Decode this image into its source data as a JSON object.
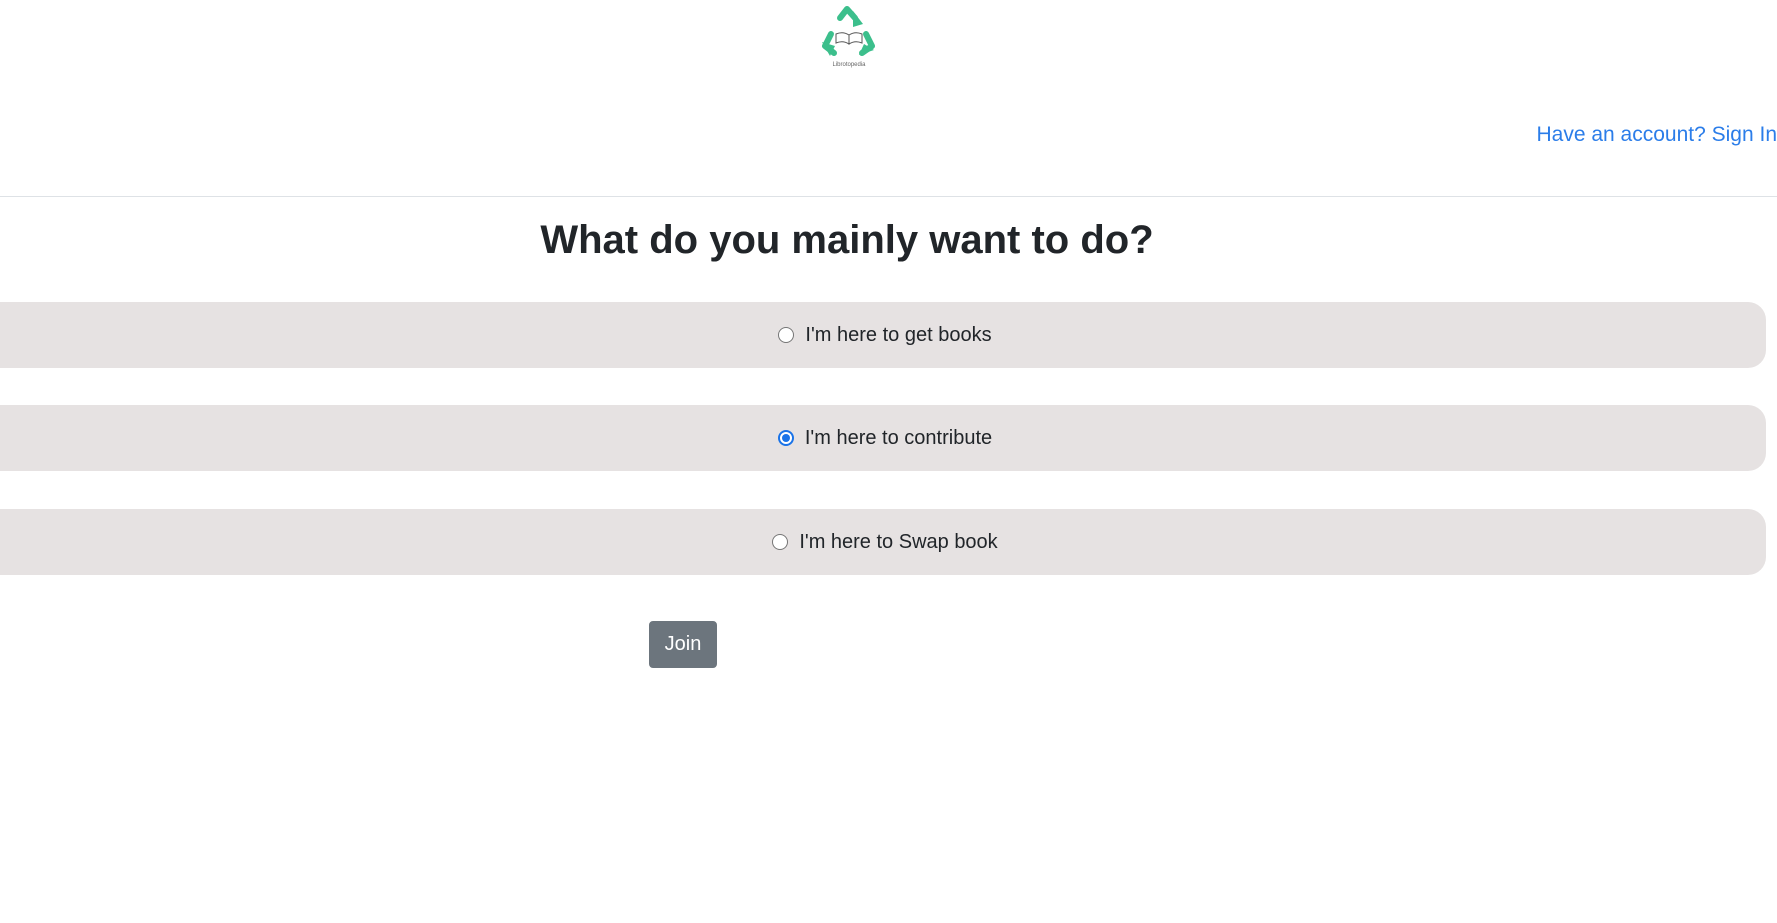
{
  "header": {
    "logo_text": "Librotopedia",
    "logo_icon": "recycle-book-icon",
    "signin_link": "Have an account? Sign In"
  },
  "main": {
    "title": "What do you mainly want to do?",
    "options": [
      {
        "label": "I'm here to get books",
        "selected": false
      },
      {
        "label": "I'm here to contribute",
        "selected": true
      },
      {
        "label": "I'm here to Swap book",
        "selected": false
      }
    ],
    "join_label": "Join"
  },
  "colors": {
    "brand_green": "#3cbf8c",
    "link_blue": "#2b7de9",
    "option_bg": "#e6e2e2",
    "button_gray": "#6c757d",
    "radio_checked": "#1a73e8"
  }
}
